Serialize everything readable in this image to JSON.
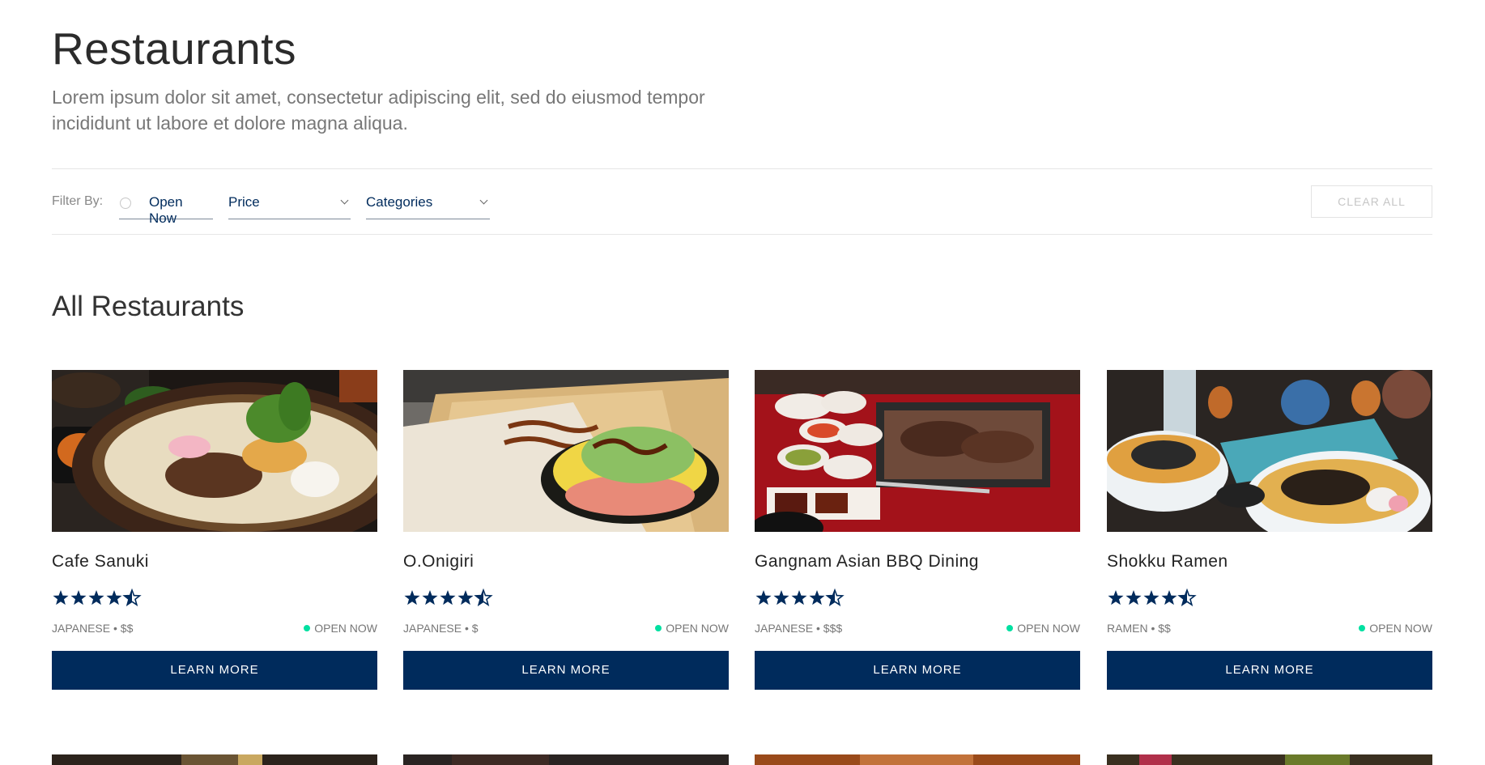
{
  "header": {
    "title": "Restaurants",
    "description": "Lorem ipsum dolor sit amet, consectetur adipiscing elit, sed do eiusmod tempor incididunt ut labore et dolore magna aliqua."
  },
  "filters": {
    "label": "Filter By:",
    "open_now": "Open Now",
    "price": "Price",
    "categories": "Categories",
    "clear_all": "CLEAR ALL"
  },
  "section": {
    "title": "All Restaurants"
  },
  "colors": {
    "navy": "#002b5c",
    "open_dot": "#00e0a1"
  },
  "restaurants": [
    {
      "name": "Cafe Sanuki",
      "rating": 4.5,
      "meta": "JAPANESE • $$",
      "status": "OPEN NOW",
      "button": "LEARN MORE",
      "photo": "udon-bowl"
    },
    {
      "name": "O.Onigiri",
      "rating": 4.5,
      "meta": "JAPANESE • $",
      "status": "OPEN NOW",
      "button": "LEARN MORE",
      "photo": "onigiri-on-mat"
    },
    {
      "name": "Gangnam Asian BBQ Dining",
      "rating": 4.5,
      "meta": "JAPANESE • $$$",
      "status": "OPEN NOW",
      "button": "LEARN MORE",
      "photo": "korean-bbq-grill"
    },
    {
      "name": "Shokku Ramen",
      "rating": 4.5,
      "meta": "RAMEN • $$",
      "status": "OPEN NOW",
      "button": "LEARN MORE",
      "photo": "ramen-table"
    }
  ]
}
